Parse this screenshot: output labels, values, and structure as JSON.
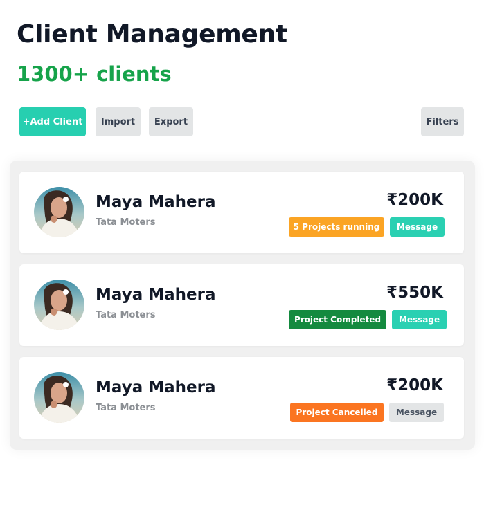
{
  "header": {
    "title": "Client Management",
    "subtitle": "1300+ clients"
  },
  "toolbar": {
    "add_label": "+Add Client",
    "import_label": "Import",
    "export_label": "Export",
    "filters_label": "Filters"
  },
  "clients": [
    {
      "name": "Maya Mahera",
      "company": "Tata Moters",
      "amount": "₹200K",
      "status": "5 Projects running",
      "status_color": "#fba424",
      "message_label": "Message",
      "message_color": "#2ad0b2"
    },
    {
      "name": "Maya Mahera",
      "company": "Tata Moters",
      "amount": "₹550K",
      "status": "Project Completed",
      "status_color": "#148a3f",
      "message_label": "Message",
      "message_color": "#2ad0b2"
    },
    {
      "name": "Maya Mahera",
      "company": "Tata Moters",
      "amount": "₹200K",
      "status": "Project Cancelled",
      "status_color": "#fb7521",
      "message_label": "Message",
      "message_color": "#e3e5e6"
    }
  ],
  "colors": {
    "accent": "#27cfb0",
    "subtitle": "#16a34a",
    "neutral_button": "#e3e5e6"
  }
}
